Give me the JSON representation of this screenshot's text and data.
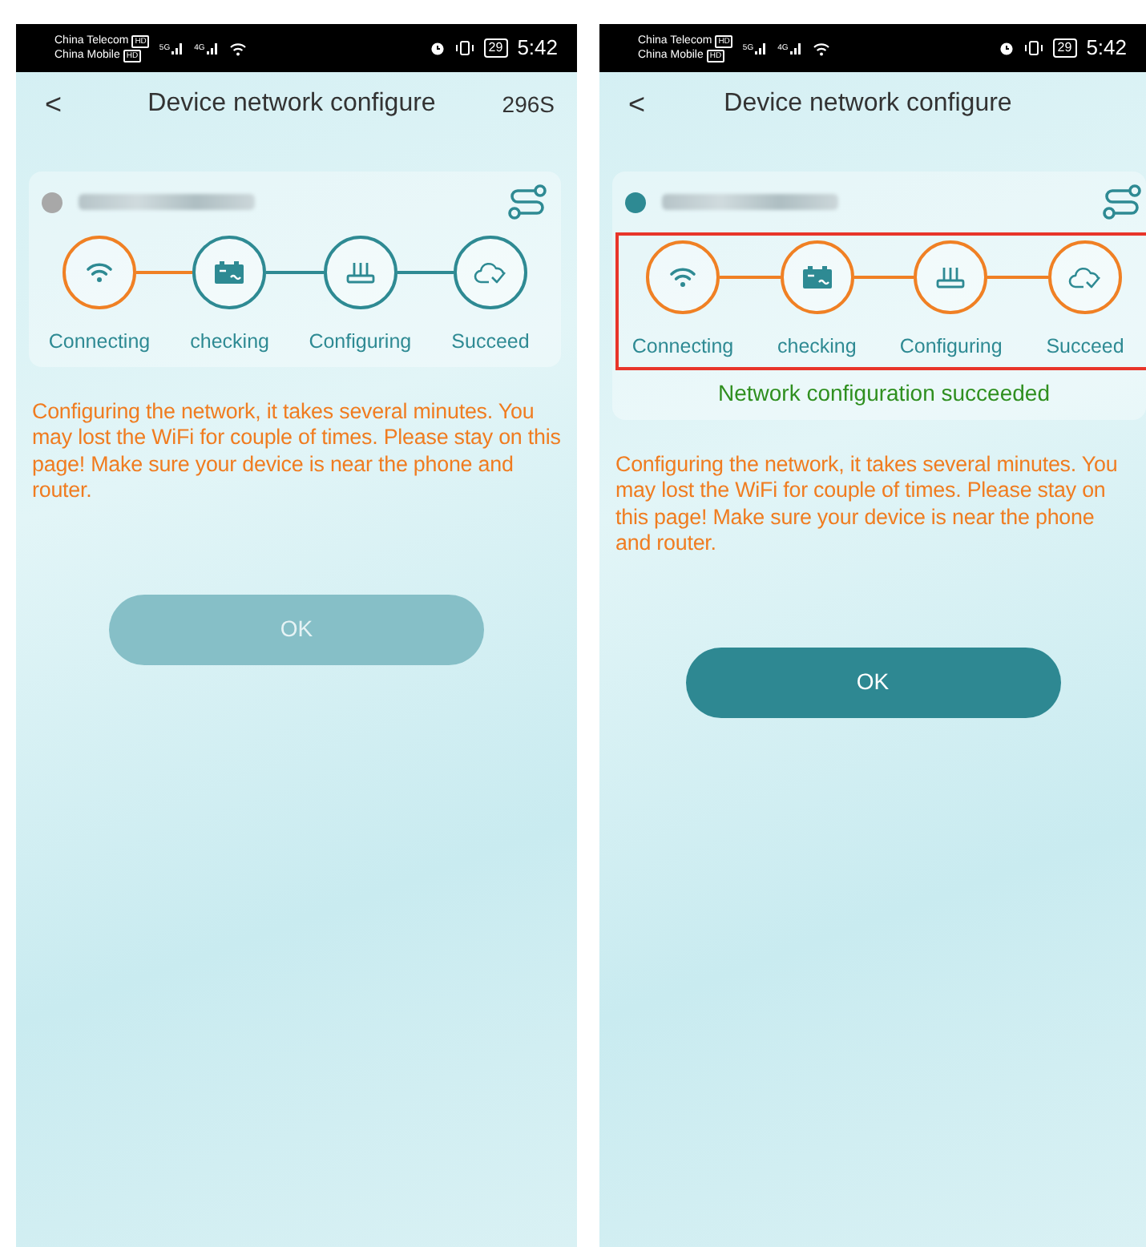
{
  "screens": [
    {
      "status_bar": {
        "carriers": [
          {
            "name": "China Telecom",
            "badge": "HD"
          },
          {
            "name": "China Mobile",
            "badge": "HD"
          }
        ],
        "networks": [
          "5G",
          "4G"
        ],
        "battery": "29",
        "time": "5:42"
      },
      "title": "Device network configure",
      "back": "<",
      "timer": "296S",
      "device": {
        "online": false
      },
      "highlighted": false,
      "steps": [
        {
          "label": "Connecting",
          "active": true
        },
        {
          "label": "checking",
          "active": false
        },
        {
          "label": "Configuring",
          "active": false
        },
        {
          "label": "Succeed",
          "active": false
        }
      ],
      "message": "Configuring the network, it takes several minutes. You may lost the WiFi for couple of times. Please stay on this page! Make sure your device is near the phone and router.",
      "ok": {
        "label": "OK",
        "disabled": true
      }
    },
    {
      "status_bar": {
        "carriers": [
          {
            "name": "China Telecom",
            "badge": "HD"
          },
          {
            "name": "China Mobile",
            "badge": "HD"
          }
        ],
        "networks": [
          "5G",
          "4G"
        ],
        "battery": "29",
        "time": "5:42"
      },
      "title": "Device network configure",
      "back": "<",
      "device": {
        "online": true
      },
      "highlighted": true,
      "steps": [
        {
          "label": "Connecting",
          "active": true
        },
        {
          "label": "checking",
          "active": true
        },
        {
          "label": "Configuring",
          "active": true
        },
        {
          "label": "Succeed",
          "active": true
        }
      ],
      "success": "Network configuration succeeded",
      "message": "Configuring the network, it takes several minutes. You may lost the WiFi for couple of times. Please stay on this page! Make sure your device is near the phone and router.",
      "ok": {
        "label": "OK",
        "disabled": false
      }
    }
  ]
}
